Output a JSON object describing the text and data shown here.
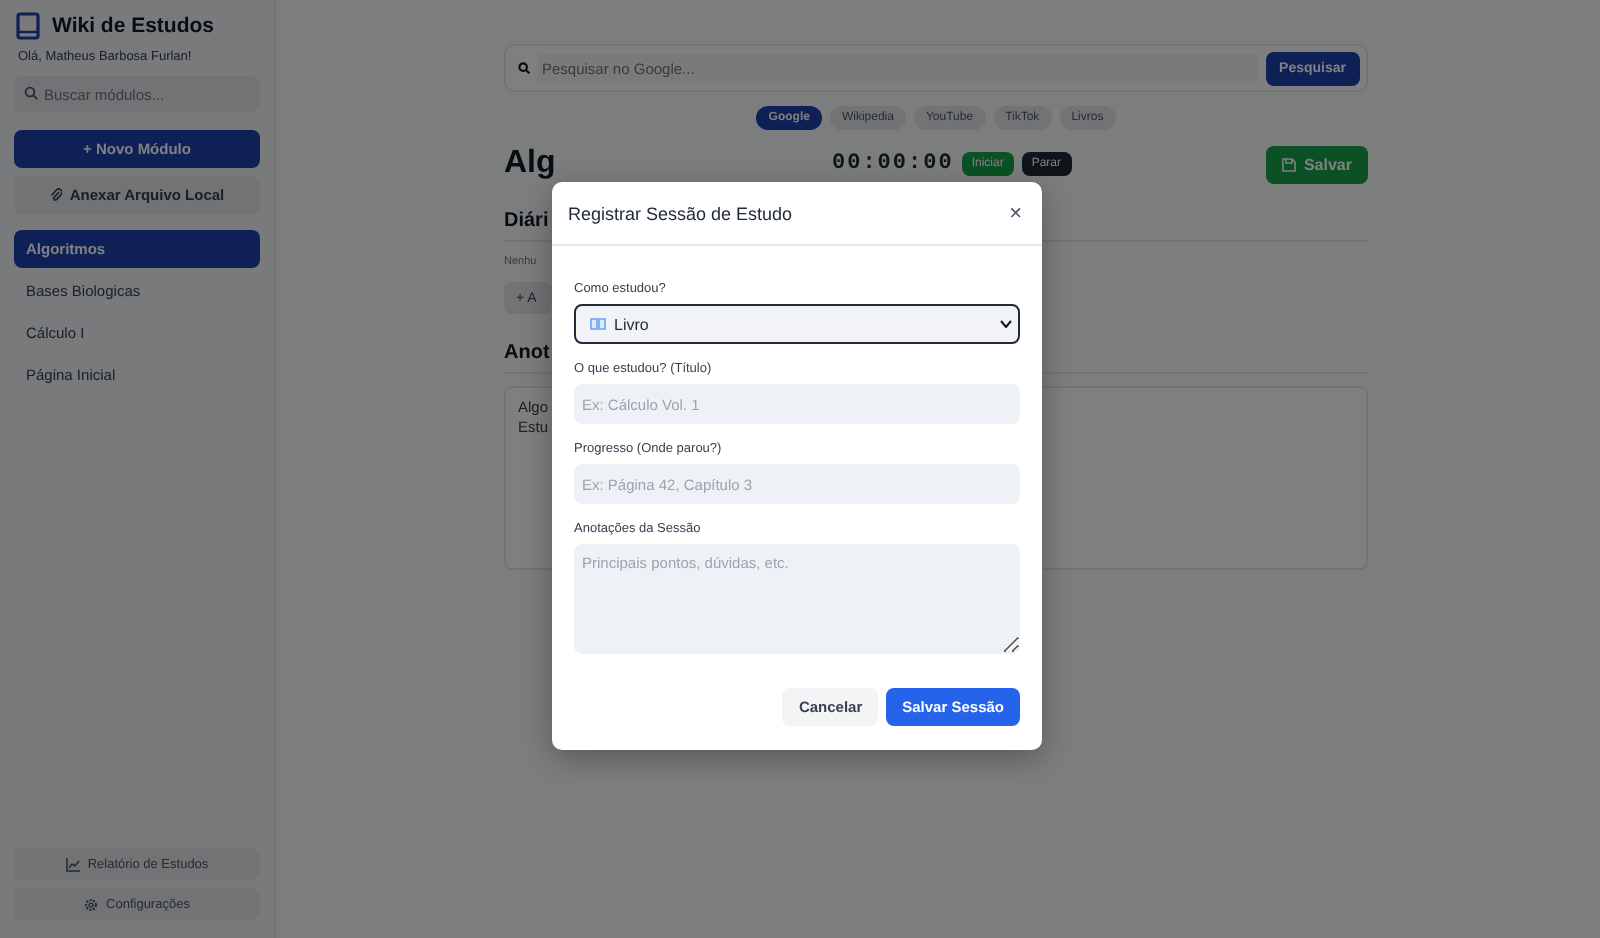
{
  "sidebar": {
    "title": "Wiki de Estudos",
    "greeting": "Olá, Matheus Barbosa Furlan!",
    "search": {
      "placeholder": "Buscar módulos..."
    },
    "new_module_button": "+ Novo Módulo",
    "attach_button": "Anexar Arquivo Local",
    "modules": [
      {
        "label": "Algoritmos",
        "selected": true
      },
      {
        "label": "Bases Biologicas",
        "selected": false
      },
      {
        "label": "Cálculo I",
        "selected": false
      },
      {
        "label": "Página Inicial",
        "selected": false
      }
    ],
    "footer_buttons": [
      {
        "kind": "report",
        "label": "Relatório de Estudos"
      },
      {
        "kind": "settings",
        "label": "Configurações"
      }
    ]
  },
  "main": {
    "search": {
      "placeholder": "Pesquisar no Google...",
      "button": "Pesquisar"
    },
    "engines": [
      {
        "label": "Google",
        "selected": true
      },
      {
        "label": "Wikipedia",
        "selected": false
      },
      {
        "label": "YouTube",
        "selected": false
      },
      {
        "label": "TikTok",
        "selected": false
      },
      {
        "label": "Livros",
        "selected": false
      }
    ],
    "page": {
      "title": "Alg",
      "timer": "00:00:00",
      "start_button": "Iniciar",
      "stop_button": "Parar",
      "save_button": "Salvar"
    },
    "diary": {
      "heading": "Diári",
      "empty_text": "Nenhu",
      "add_button": "+ A"
    },
    "notes": {
      "heading": "Anot",
      "lines": [
        "Algo",
        "Estu"
      ]
    }
  },
  "modal": {
    "title": "Registrar Sessão de Estudo",
    "close": "×",
    "fields": [
      {
        "kind": "select",
        "label": "Como estudou?",
        "value": "Livro"
      },
      {
        "kind": "input",
        "label": "O que estudou? (Título)",
        "placeholder": "Ex: Cálculo Vol. 1"
      },
      {
        "kind": "input",
        "label": "Progresso (Onde parou?)",
        "placeholder": "Ex: Página 42, Capítulo 3"
      },
      {
        "kind": "textarea",
        "label": "Anotações da Sessão",
        "placeholder": "Principais pontos, dúvidas, etc."
      }
    ],
    "cancel_button": "Cancelar",
    "submit_button": "Salvar Sessão"
  }
}
